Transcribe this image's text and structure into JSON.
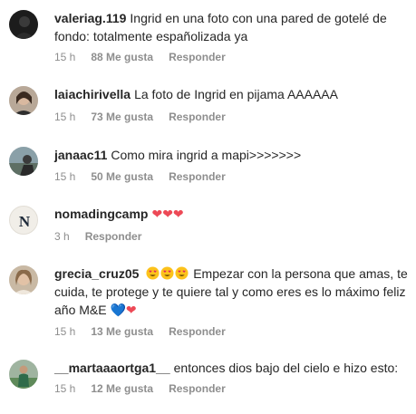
{
  "comments": [
    {
      "avatar_icon": "avatar-dark-profile",
      "username": "valeriag.119",
      "text": "Ingrid en una foto con una pared de gotelé de fondo: totalmente españolizada ya",
      "time": "15 h",
      "likes": "88 Me gusta",
      "reply": "Responder"
    },
    {
      "avatar_icon": "avatar-woman-portrait",
      "username": "laiachirivella",
      "text": "La foto de Ingrid en pijama AAAAAA",
      "time": "15 h",
      "likes": "73 Me gusta",
      "reply": "Responder"
    },
    {
      "avatar_icon": "avatar-landscape",
      "username": "janaac11",
      "text": "Como mira ingrid a mapi>>>>>>>",
      "time": "15 h",
      "likes": "50 Me gusta",
      "reply": "Responder"
    },
    {
      "avatar_icon": "avatar-letter-n-logo",
      "avatar_letter": "N",
      "username": "nomadingcamp",
      "hearts": "❤❤❤",
      "time": "3 h",
      "reply": "Responder"
    },
    {
      "avatar_icon": "avatar-woman-smiling",
      "username": "grecia_cruz05",
      "text": "Empezar con la persona que amas, te cuida, te protege y te quiere tal y como eres es lo máximo feliz año M&E",
      "emoji_hearts_end_blue": "💙",
      "emoji_hearts_end_red": "❤",
      "time": "15 h",
      "likes": "13 Me gusta",
      "reply": "Responder"
    },
    {
      "avatar_icon": "avatar-soccer-player",
      "username": "__martaaaortga1__",
      "text": "entonces dios bajo del cielo e hizo esto:",
      "time": "15 h",
      "likes": "12 Me gusta",
      "reply": "Responder"
    }
  ],
  "colors": {
    "text": "#262626",
    "meta": "#8e8e8e",
    "heart_red": "#ed4956",
    "heart_blue": "#3897f0"
  }
}
